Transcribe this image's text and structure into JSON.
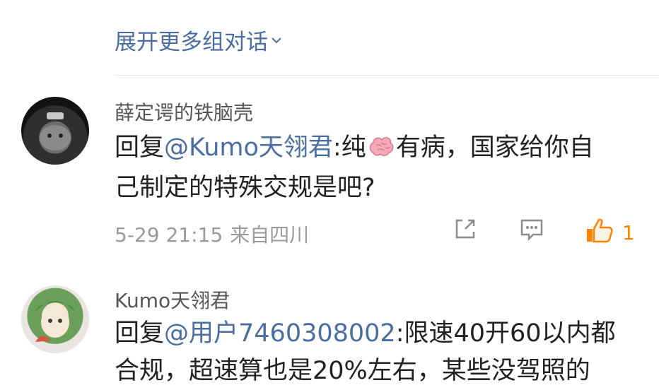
{
  "expand": {
    "label": "展开更多组对话"
  },
  "comments": [
    {
      "username": "薛定谔的铁脑壳",
      "reply_prefix": "回复",
      "mention": "@Kumo天翎君",
      "text_line1": ":纯",
      "text_line1_rest": "有病，国家给你自",
      "text_line2": "己制定的特殊交规是吧?",
      "time": "5-29 21:15",
      "location": "来自四川",
      "likes": "1"
    },
    {
      "username": "Kumo天翎君",
      "reply_prefix": "回复",
      "mention": "@用户7460308002",
      "text_line1": ":限速40开60以内都",
      "text_line2": "合规，超速算也是20%左右，某些没驾照的"
    }
  ],
  "icons": {
    "expand": "chevron-down-icon",
    "share": "share-icon",
    "comment": "comment-icon",
    "like": "thumbs-up-icon",
    "emoji": "brain-emoji-icon"
  },
  "colors": {
    "link": "#4a6ea1",
    "like": "#ff8200"
  }
}
